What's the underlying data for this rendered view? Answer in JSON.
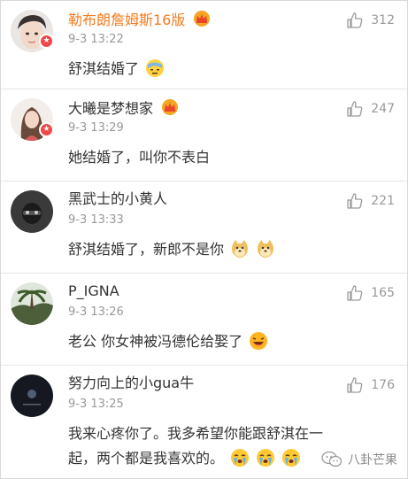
{
  "comments": [
    {
      "name": "勒布朗詹姆斯16版",
      "time": "9-3 13:22",
      "text": "舒淇结婚了",
      "likes": "312"
    },
    {
      "name": "大曦是梦想家",
      "time": "9-3 13:29",
      "text": "她结婚了，叫你不表白",
      "likes": "247"
    },
    {
      "name": "黑武士的小黄人",
      "time": "9-3 13:33",
      "text": "舒淇结婚了，新郎不是你",
      "likes": "221"
    },
    {
      "name": "P_IGNA",
      "time": "9-3 13:26",
      "text": "老公 你女神被冯德伦给娶了",
      "likes": "165"
    },
    {
      "name": "努力向上的小gua牛",
      "time": "9-3 13:25",
      "text_line1": "我来心疼你了。我多希望你能跟舒淇在一",
      "text_line2": "起，两个都是我喜欢的。",
      "likes": "176"
    }
  ],
  "watermark": "八卦芒果",
  "colors": {
    "vip_name": "#f57c1f",
    "normal_name": "#333333",
    "time": "#999999",
    "divider": "#e6e6e6",
    "badge": "#f04848"
  },
  "icons": [
    "thumbs-up-icon",
    "crown-icon",
    "verified-badge-icon",
    "emoji-icon",
    "wechat-logo-icon"
  ]
}
